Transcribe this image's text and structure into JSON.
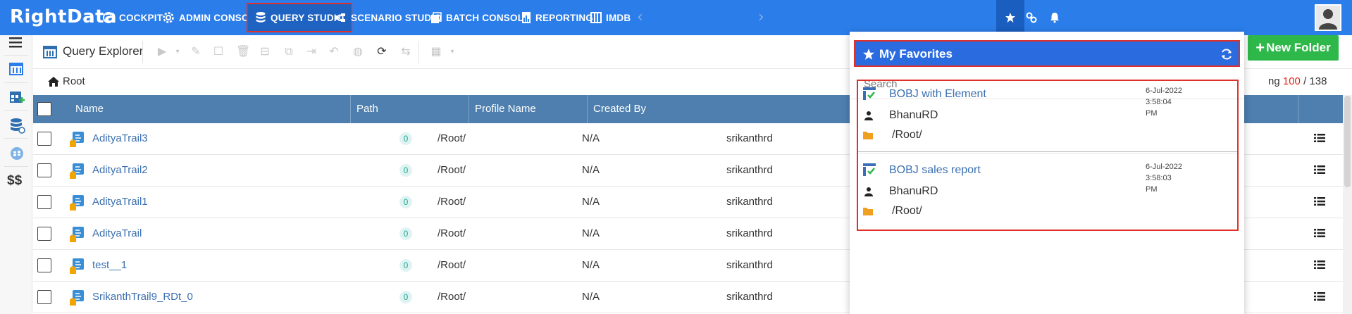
{
  "brand": {
    "logo_text": "RightData"
  },
  "nav": {
    "items": [
      {
        "label": "COCKPIT",
        "icon": "cockpit-icon"
      },
      {
        "label": "ADMIN CONSOLE",
        "icon": "gear-icon"
      },
      {
        "label": "QUERY STUDIO",
        "icon": "database-icon",
        "active": true
      },
      {
        "label": "SCENARIO STUDIO",
        "icon": "scenario-icon"
      },
      {
        "label": "BATCH CONSOLE",
        "icon": "batch-icon"
      },
      {
        "label": "REPORTING",
        "icon": "report-icon"
      },
      {
        "label": "IMDB",
        "icon": "imdb-icon"
      }
    ],
    "prev_arrow": "‹",
    "next_arrow": "›"
  },
  "toolbar": {
    "title": "Query Explorer",
    "new_folder_label": "New Folder",
    "new_folder_prefix": "+"
  },
  "breadcrumb": {
    "root_label": "Root"
  },
  "pagination": {
    "prefix": "ng",
    "shown": "100",
    "separator": "/",
    "total": "138"
  },
  "grid": {
    "columns": [
      "Name",
      "Path",
      "Profile Name",
      "Created By"
    ],
    "rows": [
      {
        "name": "AdityaTrail3",
        "count": "0",
        "path": "/Root/",
        "profile": "N/A",
        "created_by": "srikanthrd"
      },
      {
        "name": "AdityaTrail2",
        "count": "0",
        "path": "/Root/",
        "profile": "N/A",
        "created_by": "srikanthrd"
      },
      {
        "name": "AdityaTrail1",
        "count": "0",
        "path": "/Root/",
        "profile": "N/A",
        "created_by": "srikanthrd"
      },
      {
        "name": "AdityaTrail",
        "count": "0",
        "path": "/Root/",
        "profile": "N/A",
        "created_by": "srikanthrd"
      },
      {
        "name": "test__1",
        "count": "0",
        "path": "/Root/",
        "profile": "N/A",
        "created_by": "srikanthrd"
      },
      {
        "name": "SrikanthTrail9_RDt_0",
        "count": "0",
        "path": "/Root/",
        "profile": "N/A",
        "created_by": "srikanthrd"
      }
    ]
  },
  "favorites": {
    "title": "My Favorites",
    "search_placeholder": "Search",
    "items": [
      {
        "name": "BOBJ with Element",
        "date": "6-Jul-2022 3:58:04",
        "time_suffix": "PM",
        "user": "BhanuRD",
        "path": "/Root/"
      },
      {
        "name": "BOBJ sales report",
        "date": "6-Jul-2022 3:58:03",
        "time_suffix": "PM",
        "user": "BhanuRD",
        "path": "/Root/"
      }
    ]
  },
  "colors": {
    "topbar": "#2b7de9",
    "grid_header": "#4e7fae",
    "highlight_border": "#e0302a",
    "new_folder": "#2fb84a",
    "link": "#3b6fb0"
  }
}
